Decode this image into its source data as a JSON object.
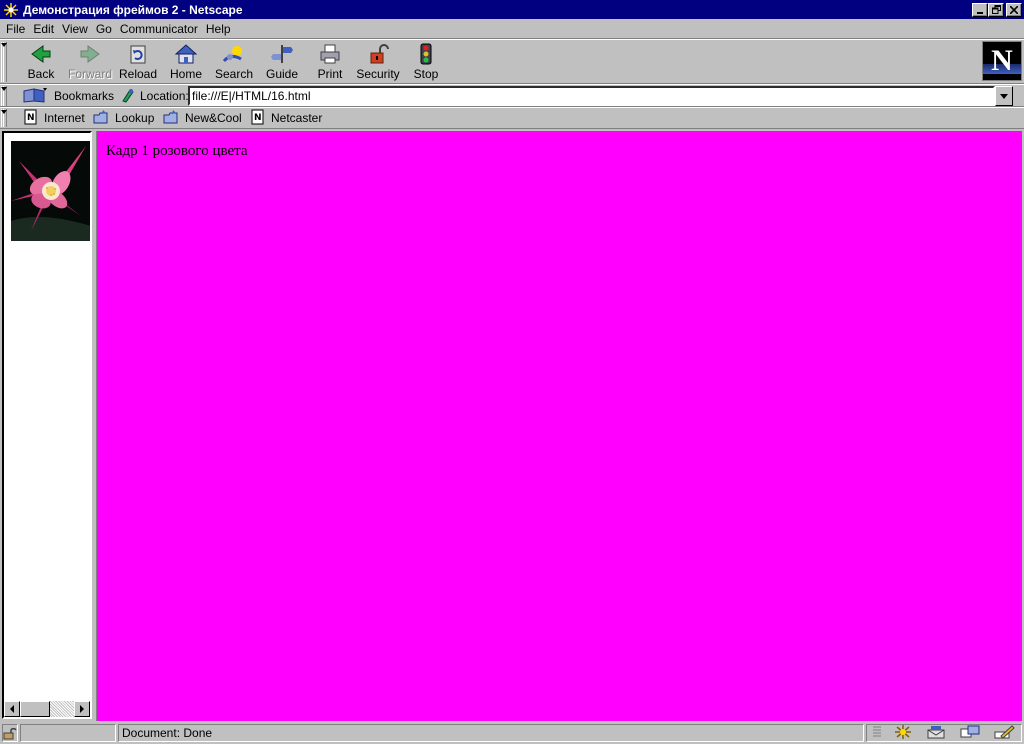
{
  "window": {
    "title": "Демонстрация фреймов 2 - Netscape"
  },
  "menu": {
    "items": [
      "File",
      "Edit",
      "View",
      "Go",
      "Communicator",
      "Help"
    ]
  },
  "navigation": {
    "buttons": [
      {
        "label": "Back",
        "icon": "back-arrow-icon"
      },
      {
        "label": "Forward",
        "icon": "forward-arrow-icon"
      },
      {
        "label": "Reload",
        "icon": "reload-icon"
      },
      {
        "label": "Home",
        "icon": "home-icon"
      },
      {
        "label": "Search",
        "icon": "search-icon"
      },
      {
        "label": "Guide",
        "icon": "guide-icon"
      },
      {
        "label": "Print",
        "icon": "printer-icon"
      },
      {
        "label": "Security",
        "icon": "padlock-icon"
      },
      {
        "label": "Stop",
        "icon": "stop-light-icon"
      }
    ]
  },
  "location": {
    "bookmarks_label": "Bookmarks",
    "label": "Location:",
    "url": "file:///E|/HTML/16.html"
  },
  "personal_toolbar": {
    "items": [
      "Internet",
      "Lookup",
      "New&Cool",
      "Netcaster"
    ]
  },
  "logo": {
    "letter": "N"
  },
  "frames": {
    "right_text": "Кадр 1 розового цвета",
    "right_bg": "#ff00ff"
  },
  "status": {
    "text": "Document: Done"
  },
  "colors": {
    "titlebar": "#000080",
    "chrome": "#c0c0c0"
  }
}
